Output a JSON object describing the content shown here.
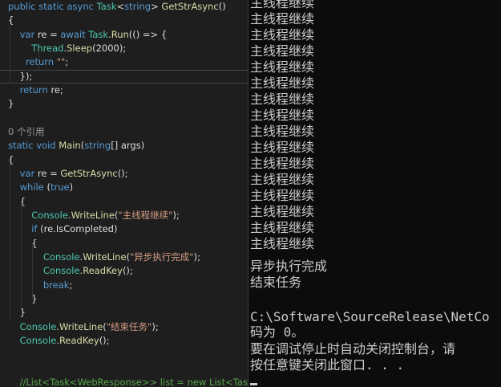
{
  "colors": {
    "keyword": "#569cd6",
    "type": "#4ec9b0",
    "method": "#dcdcaa",
    "string": "#d69d85",
    "comment": "#57a64a",
    "plain": "#dcdcdc",
    "codelens": "#999999",
    "console_text": "#cccccc"
  },
  "editor": {
    "lines": [
      {
        "kind": "code",
        "tokens": [
          [
            "public",
            "keyword"
          ],
          [
            " ",
            "plain"
          ],
          [
            "static",
            "keyword"
          ],
          [
            " ",
            "plain"
          ],
          [
            "async",
            "keyword"
          ],
          [
            " ",
            "plain"
          ],
          [
            "Task",
            "type"
          ],
          [
            "<",
            "plain"
          ],
          [
            "string",
            "keyword"
          ],
          [
            "> ",
            "plain"
          ],
          [
            "GetStrAsync",
            "method"
          ],
          [
            "()",
            "plain"
          ]
        ]
      },
      {
        "kind": "code",
        "tokens": [
          [
            "{",
            "plain"
          ]
        ]
      },
      {
        "kind": "code",
        "tokens": [
          [
            "    ",
            "plain"
          ],
          [
            "var",
            "keyword"
          ],
          [
            " re = ",
            "plain"
          ],
          [
            "await",
            "keyword"
          ],
          [
            " ",
            "plain"
          ],
          [
            "Task",
            "type"
          ],
          [
            ".",
            "plain"
          ],
          [
            "Run",
            "method"
          ],
          [
            "(() => {",
            "plain"
          ]
        ]
      },
      {
        "kind": "code",
        "tokens": [
          [
            "        ",
            "plain"
          ],
          [
            "Thread",
            "type"
          ],
          [
            ".",
            "plain"
          ],
          [
            "Sleep",
            "method"
          ],
          [
            "(2000);",
            "plain"
          ]
        ]
      },
      {
        "kind": "code",
        "tokens": [
          [
            "      ",
            "plain"
          ],
          [
            "return",
            "keyword"
          ],
          [
            " ",
            "plain"
          ],
          [
            "\"\"",
            "string"
          ],
          [
            ";",
            "plain"
          ]
        ]
      },
      {
        "kind": "code",
        "current": true,
        "tokens": [
          [
            "    });",
            "plain"
          ]
        ]
      },
      {
        "kind": "code",
        "tokens": [
          [
            "    ",
            "plain"
          ],
          [
            "return",
            "keyword"
          ],
          [
            " re;",
            "plain"
          ]
        ]
      },
      {
        "kind": "code",
        "tokens": [
          [
            "}",
            "plain"
          ]
        ]
      },
      {
        "kind": "blank",
        "tokens": []
      },
      {
        "kind": "codelens",
        "tokens": [
          [
            "0 个引用",
            "codelens"
          ]
        ]
      },
      {
        "kind": "code",
        "tokens": [
          [
            "static",
            "keyword"
          ],
          [
            " ",
            "plain"
          ],
          [
            "void",
            "keyword"
          ],
          [
            " ",
            "plain"
          ],
          [
            "Main",
            "method"
          ],
          [
            "(",
            "plain"
          ],
          [
            "string",
            "keyword"
          ],
          [
            "[] ",
            "plain"
          ],
          [
            "args",
            "plain"
          ],
          [
            ")",
            "plain"
          ]
        ]
      },
      {
        "kind": "code",
        "tokens": [
          [
            "{",
            "plain"
          ]
        ]
      },
      {
        "kind": "code",
        "tokens": [
          [
            "    ",
            "plain"
          ],
          [
            "var",
            "keyword"
          ],
          [
            " re = ",
            "plain"
          ],
          [
            "GetStrAsync",
            "method"
          ],
          [
            "();",
            "plain"
          ]
        ]
      },
      {
        "kind": "code",
        "tokens": [
          [
            "    ",
            "plain"
          ],
          [
            "while",
            "keyword"
          ],
          [
            " (",
            "plain"
          ],
          [
            "true",
            "keyword"
          ],
          [
            ")",
            "plain"
          ]
        ]
      },
      {
        "kind": "code",
        "tokens": [
          [
            "    {",
            "plain"
          ]
        ]
      },
      {
        "kind": "code",
        "tokens": [
          [
            "        ",
            "plain"
          ],
          [
            "Console",
            "type"
          ],
          [
            ".",
            "plain"
          ],
          [
            "WriteLine",
            "method"
          ],
          [
            "(",
            "plain"
          ],
          [
            "\"主线程继续\"",
            "string"
          ],
          [
            ");",
            "plain"
          ]
        ]
      },
      {
        "kind": "code",
        "tokens": [
          [
            "        ",
            "plain"
          ],
          [
            "if",
            "keyword"
          ],
          [
            " (re.IsCompleted)",
            "plain"
          ]
        ]
      },
      {
        "kind": "code",
        "tokens": [
          [
            "        {",
            "plain"
          ]
        ]
      },
      {
        "kind": "code",
        "tokens": [
          [
            "            ",
            "plain"
          ],
          [
            "Console",
            "type"
          ],
          [
            ".",
            "plain"
          ],
          [
            "WriteLine",
            "method"
          ],
          [
            "(",
            "plain"
          ],
          [
            "\"异步执行完成\"",
            "string"
          ],
          [
            ");",
            "plain"
          ]
        ]
      },
      {
        "kind": "code",
        "tokens": [
          [
            "            ",
            "plain"
          ],
          [
            "Console",
            "type"
          ],
          [
            ".",
            "plain"
          ],
          [
            "ReadKey",
            "method"
          ],
          [
            "();",
            "plain"
          ]
        ]
      },
      {
        "kind": "code",
        "tokens": [
          [
            "            ",
            "plain"
          ],
          [
            "break",
            "keyword"
          ],
          [
            ";",
            "plain"
          ]
        ]
      },
      {
        "kind": "code",
        "tokens": [
          [
            "        }",
            "plain"
          ]
        ]
      },
      {
        "kind": "code",
        "tokens": [
          [
            "    }",
            "plain"
          ]
        ]
      },
      {
        "kind": "code",
        "tokens": [
          [
            "    ",
            "plain"
          ],
          [
            "Console",
            "type"
          ],
          [
            ".",
            "plain"
          ],
          [
            "WriteLine",
            "method"
          ],
          [
            "(",
            "plain"
          ],
          [
            "\"结束任务\"",
            "string"
          ],
          [
            ");",
            "plain"
          ]
        ]
      },
      {
        "kind": "code",
        "tokens": [
          [
            "    ",
            "plain"
          ],
          [
            "Console",
            "type"
          ],
          [
            ".",
            "plain"
          ],
          [
            "ReadKey",
            "method"
          ],
          [
            "();",
            "plain"
          ]
        ]
      },
      {
        "kind": "blank",
        "tokens": []
      },
      {
        "kind": "blank",
        "tokens": []
      },
      {
        "kind": "code",
        "tokens": [
          [
            "    ",
            "plain"
          ],
          [
            "//List<Task<WebResponse>> list = new List<Task<WebResponse>>();",
            "comment"
          ]
        ]
      }
    ]
  },
  "console": {
    "lines": [
      "主线程继续",
      "主线程继续",
      "主线程继续",
      "主线程继续",
      "主线程继续",
      "主线程继续",
      "主线程继续",
      "主线程继续",
      "主线程继续",
      "主线程继续",
      "主线程继续",
      "主线程继续",
      "主线程继续",
      "主线程继续",
      "主线程继续",
      "主线程继续",
      "异步执行完成",
      "结束任务",
      "",
      "C:\\Software\\SourceRelease\\NetCo",
      "码为 0。",
      "要在调试停止时自动关闭控制台，请",
      "按任意键关闭此窗口. . ."
    ]
  }
}
